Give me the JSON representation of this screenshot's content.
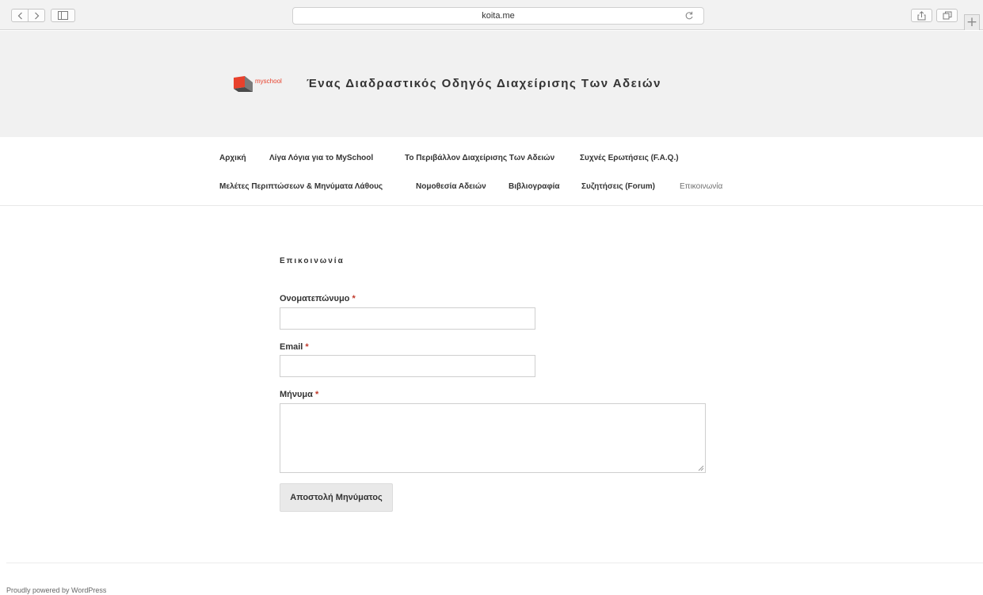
{
  "browser": {
    "url": "koita.me"
  },
  "site": {
    "logo_text": "myschool",
    "title": "Ένας Διαδραστικός Οδηγός Διαχείρισης Των Αδειών"
  },
  "nav": {
    "items": [
      {
        "label": "Αρχική"
      },
      {
        "label": "Λίγα Λόγια για το MySchool"
      },
      {
        "label": "Το Περιβάλλον Διαχείρισης Των Αδειών"
      },
      {
        "label": "Συχνές Ερωτήσεις (F.A.Q.)"
      },
      {
        "label": "Μελέτες Περιπτώσεων & Μηνύματα Λάθους"
      },
      {
        "label": "Νομοθεσία Αδειών"
      },
      {
        "label": "Βιβλιογραφία"
      },
      {
        "label": "Συζητήσεις (Forum)"
      },
      {
        "label": "Επικοινωνία"
      }
    ]
  },
  "page": {
    "title": "Επικοινωνία"
  },
  "form": {
    "name_label": "Ονοματεπώνυμο",
    "email_label": "Email",
    "message_label": "Μήνυμα",
    "required_mark": "*",
    "name_value": "",
    "email_value": "",
    "message_value": "",
    "submit_label": "Αποστολή Μηνύματος"
  },
  "footer": {
    "text": "Proudly powered by WordPress"
  },
  "colors": {
    "header_bg": "#f1f1f1",
    "required": "#c0392b",
    "logo_red": "#e8412c"
  }
}
